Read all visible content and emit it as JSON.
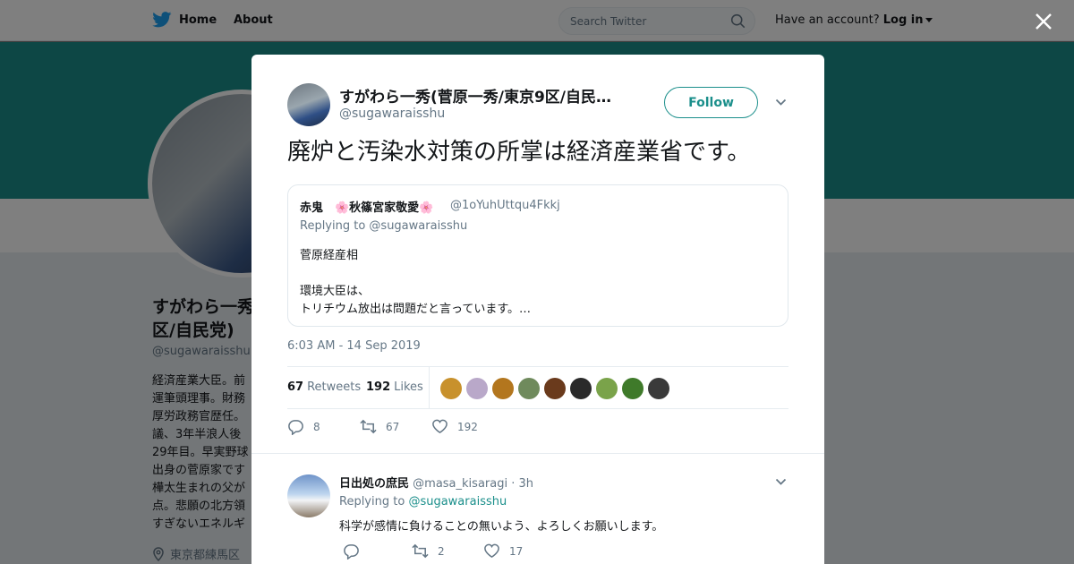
{
  "topbar": {
    "home_label": "Home",
    "about_label": "About",
    "search_placeholder": "Search Twitter",
    "account_prompt": "Have an account?",
    "login_label": "Log in"
  },
  "profile": {
    "name": "すがわら一秀(菅原一秀/東京9区/自民党)",
    "handle": "@sugawaraisshu",
    "bio": [
      "経済産業大臣。前",
      "運筆頭理事。財務",
      "厚労政務官歴任。",
      "議、3年半浪人後",
      "29年目。早実野球",
      "出身の菅原家です",
      "樺太生まれの父が",
      "点。悲願の北方領",
      "すぎないエネルギ"
    ],
    "location": "東京都練馬区"
  },
  "tweet": {
    "author_name": "すがわら一秀(菅原一秀/東京9区/自民…",
    "author_handle": "@sugawaraisshu",
    "follow_label": "Follow",
    "text": "廃炉と汚染水対策の所掌は経済産業省です。",
    "quote": {
      "author_name": "赤鬼　🌸秋篠宮家敬愛🌸",
      "author_handle": "@1oYuhUttqu4Fkkj",
      "replying_to": "Replying to @sugawaraisshu",
      "lines": [
        "菅原経産相",
        "",
        "環境大臣は、",
        "トリチウム放出は問題だと言っています。…"
      ]
    },
    "timestamp": "6:03 AM - 14 Sep 2019",
    "retweets_count": "67",
    "retweets_label": "Retweets",
    "likes_count": "192",
    "likes_label": "Likes",
    "actions": {
      "replies": "8",
      "retweets": "67",
      "likes": "192"
    }
  },
  "reply": {
    "author_name": "日出処の庶民",
    "author_handle": "@masa_kisaragi",
    "time": "· 3h",
    "replying_prefix": "Replying to",
    "replying_handle": "@sugawaraisshu",
    "text": "科学が感情に負けることの無いよう、よろしくお願いします。",
    "actions": {
      "replies": "",
      "retweets": "2",
      "likes": "17"
    }
  },
  "colors": {
    "brand": "#1da1f2",
    "accent": "#1b8f8b",
    "muted": "#657786",
    "liker_avatars": [
      "#c8912c",
      "#b9a8c9",
      "#b3761e",
      "#6f8a5c",
      "#6a3a1c",
      "#2a2a2a",
      "#7aa34a",
      "#3f7a2a",
      "#3a3a3a"
    ]
  }
}
